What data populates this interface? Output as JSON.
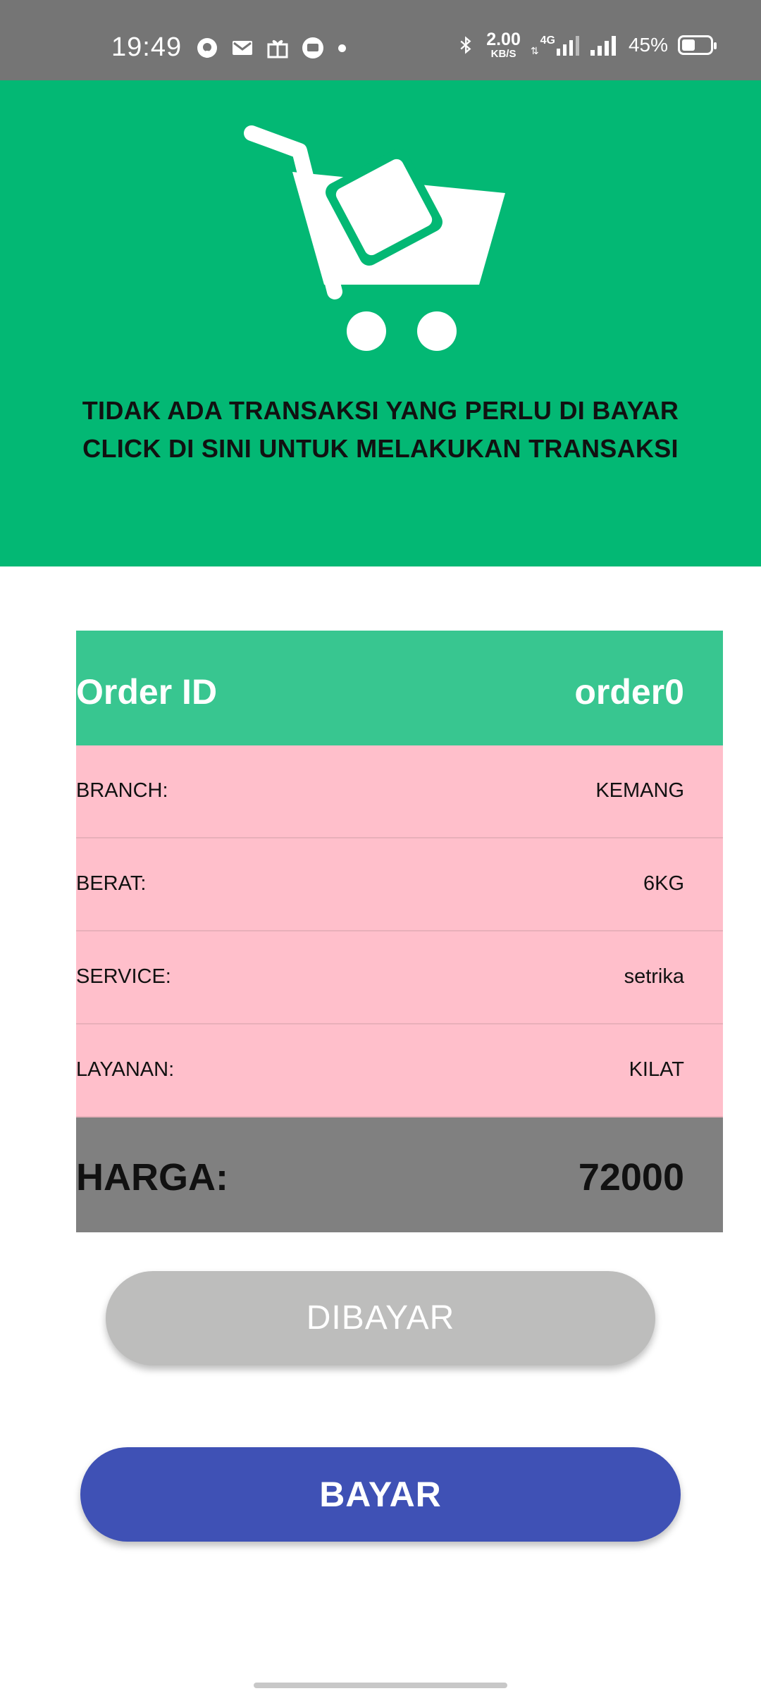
{
  "status_bar": {
    "time": "19:49",
    "net_speed_value": "2.00",
    "net_speed_unit": "KB/S",
    "network_type": "4G",
    "battery_percent": "45%",
    "battery_level": 0.45,
    "icons": [
      "record-icon",
      "gmail-icon",
      "gift-icon",
      "message-icon",
      "notification-dot",
      "bluetooth-icon",
      "data-arrows-icon",
      "signal-icon",
      "battery-icon"
    ]
  },
  "banner": {
    "icon": "cart-icon",
    "line1": "TIDAK ADA TRANSAKSI YANG PERLU DI BAYAR",
    "line2": "CLICK DI SINI UNTUK MELAKUKAN TRANSAKSI",
    "color": "#03b874"
  },
  "order": {
    "id_label": "Order ID",
    "id_value": "order0",
    "rows": [
      {
        "label": "BRANCH:",
        "value": "KEMANG"
      },
      {
        "label": "BERAT:",
        "value": "6KG"
      },
      {
        "label": "SERVICE:",
        "value": "setrika"
      },
      {
        "label": "LAYANAN:",
        "value": "KILAT"
      }
    ],
    "price_label": "HARGA:",
    "price_value": "72000"
  },
  "buttons": {
    "paid_label": "DIBAYAR",
    "pay_label": "BAYAR"
  },
  "colors": {
    "header_green": "#38c690",
    "row_pink": "#ffbfcb",
    "price_gray": "#808080",
    "pay_blue": "#3f51b5",
    "paid_gray": "#bdbdbc"
  }
}
